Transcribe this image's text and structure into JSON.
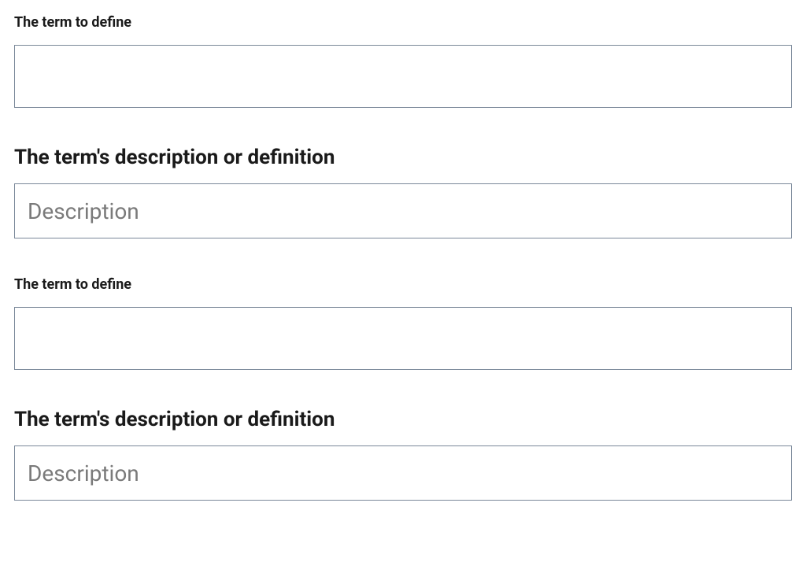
{
  "entries": [
    {
      "term_label": "The term to define",
      "term_value": "",
      "term_placeholder": "",
      "description_label": "The term's description or definition",
      "description_value": "",
      "description_placeholder": "Description"
    },
    {
      "term_label": "The term to define",
      "term_value": "",
      "term_placeholder": "",
      "description_label": "The term's description or definition",
      "description_value": "",
      "description_placeholder": "Description"
    }
  ]
}
